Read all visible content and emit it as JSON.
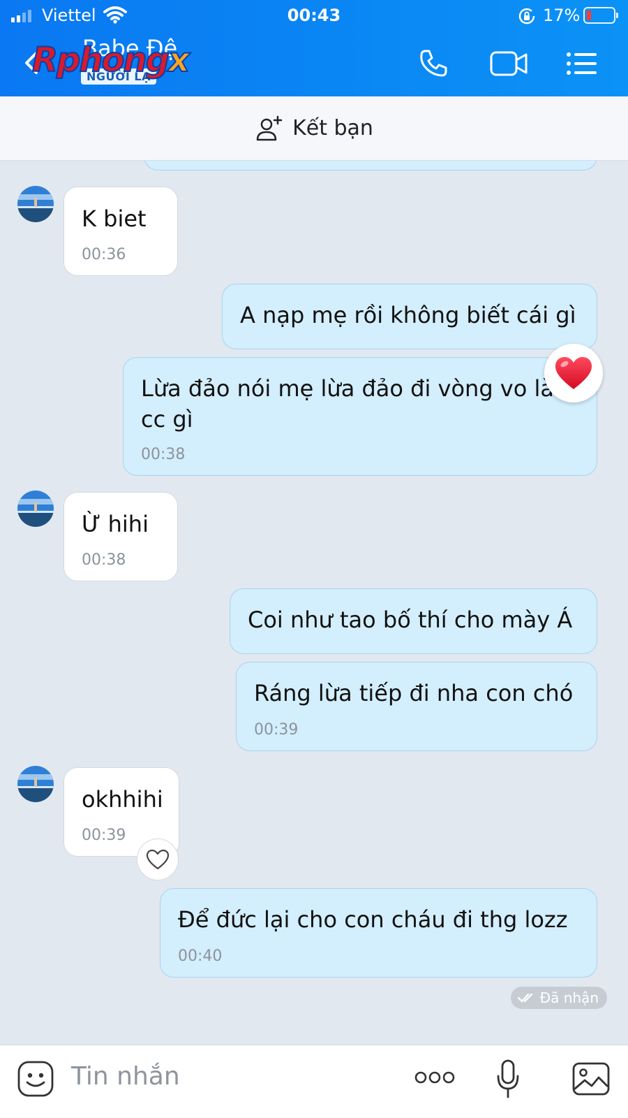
{
  "status_bar": {
    "carrier": "Viettel",
    "time": "00:43",
    "battery_percent": "17%",
    "battery_level": 0.17,
    "icons": [
      "signal-icon",
      "wifi-icon",
      "rotation-lock-icon",
      "battery-icon"
    ]
  },
  "header": {
    "name": "Babe Đệ",
    "badge": "NGƯỜI LẠ",
    "watermark": {
      "main": "Rphong",
      "accent": "x"
    },
    "icons": [
      "back-icon",
      "phone-icon",
      "video-icon",
      "menu-icon"
    ]
  },
  "friend_bar": {
    "label": "Kết bạn",
    "icon": "add-friend-icon"
  },
  "messages": [
    {
      "from": "them",
      "text": "K biet",
      "time": "00:36"
    },
    {
      "from": "me",
      "text": "A nạp mẹ rồi không biết cái gì"
    },
    {
      "from": "me",
      "lines": [
        "Lừa đảo nói mẹ lừa đảo đi vòng vo làm",
        "cc gì"
      ],
      "time": "00:38",
      "reaction": "heart"
    },
    {
      "from": "them",
      "text": "Ừ hihi",
      "time": "00:38"
    },
    {
      "from": "me",
      "text": "Coi như tao bố thí cho mày Á"
    },
    {
      "from": "me",
      "text": "Ráng lừa tiếp đi nha con chó",
      "time": "00:39"
    },
    {
      "from": "them",
      "text": "okhhihi",
      "time": "00:39"
    },
    {
      "from": "me",
      "text": "Để đức lại cho con cháu đi thg lozz",
      "time": "00:40"
    }
  ],
  "delivery_status": "Đã nhận",
  "colors": {
    "header": "#0b8af4",
    "outgoing_bubble": "#d3eefc",
    "incoming_bubble": "#ffffff",
    "chat_background": "#e2e8f0",
    "heart": "#e8112d"
  },
  "input": {
    "placeholder": "Tin nhắn",
    "icons": [
      "emoji-icon",
      "more-icon",
      "microphone-icon",
      "image-icon"
    ]
  }
}
